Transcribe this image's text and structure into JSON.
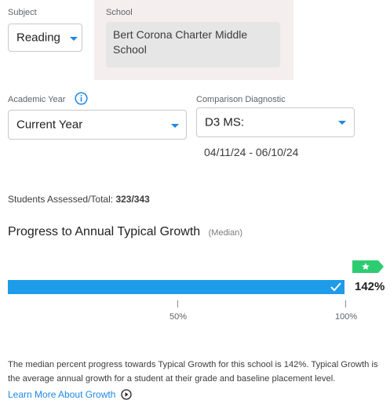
{
  "subject": {
    "label": "Subject",
    "value": "Reading"
  },
  "school": {
    "label": "School",
    "value": "Bert Corona Charter Middle School"
  },
  "academic_year": {
    "label": "Academic Year",
    "value": "Current Year"
  },
  "comparison": {
    "label": "Comparison Diagnostic",
    "value": "D3 MS:",
    "date_range": "04/11/24 - 06/10/24"
  },
  "students": {
    "label": "Students Assessed/Total:",
    "value": "323/343"
  },
  "progress": {
    "title": "Progress to Annual Typical Growth",
    "subtitle": "(Median)",
    "percent": 142,
    "value_label": "142%",
    "tick_50": "50%",
    "tick_100": "100%"
  },
  "description": "The median percent progress towards Typical Growth for this school is 142%. Typical Growth is the average annual growth for a student at their grade and baseline placement level.",
  "learn_more": "Learn More About Growth",
  "colors": {
    "accent": "#1e88e5",
    "bar": "#1e9be9",
    "badge": "#2ecc71",
    "panel": "#f4eeee"
  },
  "icons": {
    "info": "info-icon",
    "check": "checkmark-icon",
    "star": "star-icon",
    "play": "play-circle-icon"
  }
}
